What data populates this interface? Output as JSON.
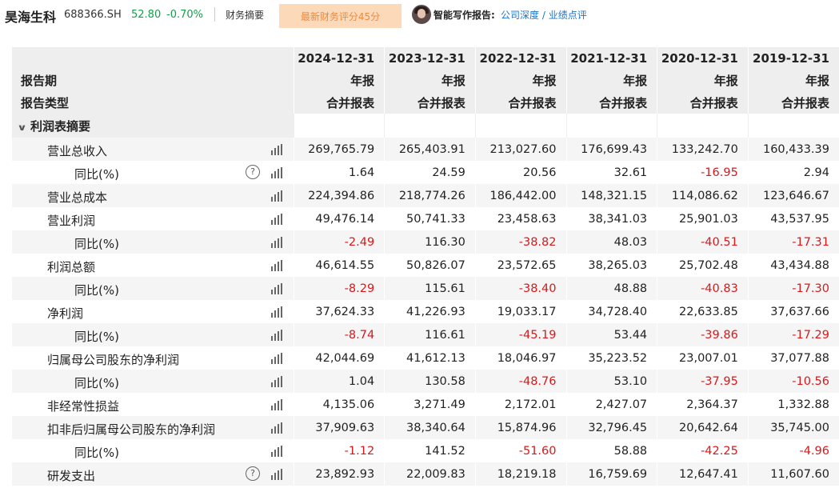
{
  "header": {
    "stock_name": "昊海生科",
    "stock_code": "688366.SH",
    "price": "52.80",
    "change_pct": "-0.70%",
    "tab_summary": "财务摘要",
    "score_button": "最新财务评分45分",
    "report_label": "智能写作报告:",
    "report_link_1": "公司深度",
    "report_link_sep": " / ",
    "report_link_2": "业绩点评",
    "colors": {
      "down": "#14a04a",
      "negative": "#d7191c",
      "link": "#1b74c8",
      "score_bg": "#fcd9b8",
      "score_text": "#f08a3b"
    }
  },
  "table": {
    "label_period": "报告期",
    "label_type": "报告类型",
    "columns": [
      {
        "date": "2024-12-31",
        "period": "年报",
        "type": "合并报表"
      },
      {
        "date": "2023-12-31",
        "period": "年报",
        "type": "合并报表"
      },
      {
        "date": "2022-12-31",
        "period": "年报",
        "type": "合并报表"
      },
      {
        "date": "2021-12-31",
        "period": "年报",
        "type": "合并报表"
      },
      {
        "date": "2020-12-31",
        "period": "年报",
        "type": "合并报表"
      },
      {
        "date": "2019-12-31",
        "period": "年报",
        "type": "合并报表"
      }
    ],
    "section_title": "利润表摘要",
    "rows": [
      {
        "label": "营业总收入",
        "level": 1,
        "help": false,
        "values": [
          "269,765.79",
          "265,403.91",
          "213,027.60",
          "176,699.43",
          "133,242.70",
          "160,433.39"
        ]
      },
      {
        "label": "同比(%)",
        "level": 2,
        "help": true,
        "values": [
          "1.64",
          "24.59",
          "20.56",
          "32.61",
          "-16.95",
          "2.94"
        ]
      },
      {
        "label": "营业总成本",
        "level": 1,
        "help": false,
        "values": [
          "224,394.86",
          "218,774.26",
          "186,442.00",
          "148,321.15",
          "114,086.62",
          "123,646.67"
        ]
      },
      {
        "label": "营业利润",
        "level": 1,
        "help": false,
        "values": [
          "49,476.14",
          "50,741.33",
          "23,458.63",
          "38,341.03",
          "25,901.03",
          "43,537.95"
        ]
      },
      {
        "label": "同比(%)",
        "level": 2,
        "help": false,
        "values": [
          "-2.49",
          "116.30",
          "-38.82",
          "48.03",
          "-40.51",
          "-17.31"
        ]
      },
      {
        "label": "利润总额",
        "level": 1,
        "help": false,
        "values": [
          "46,614.55",
          "50,826.07",
          "23,572.65",
          "38,265.03",
          "25,702.48",
          "43,434.88"
        ]
      },
      {
        "label": "同比(%)",
        "level": 2,
        "help": false,
        "values": [
          "-8.29",
          "115.61",
          "-38.40",
          "48.88",
          "-40.83",
          "-17.30"
        ]
      },
      {
        "label": "净利润",
        "level": 1,
        "help": false,
        "values": [
          "37,624.33",
          "41,226.93",
          "19,033.17",
          "34,728.40",
          "22,633.85",
          "37,637.66"
        ]
      },
      {
        "label": "同比(%)",
        "level": 2,
        "help": false,
        "values": [
          "-8.74",
          "116.61",
          "-45.19",
          "53.44",
          "-39.86",
          "-17.29"
        ]
      },
      {
        "label": "归属母公司股东的净利润",
        "level": 1,
        "help": false,
        "values": [
          "42,044.69",
          "41,612.13",
          "18,046.97",
          "35,223.52",
          "23,007.01",
          "37,077.88"
        ]
      },
      {
        "label": "同比(%)",
        "level": 2,
        "help": false,
        "values": [
          "1.04",
          "130.58",
          "-48.76",
          "53.10",
          "-37.95",
          "-10.56"
        ]
      },
      {
        "label": "非经常性损益",
        "level": 1,
        "help": false,
        "values": [
          "4,135.06",
          "3,271.49",
          "2,172.01",
          "2,427.07",
          "2,364.37",
          "1,332.88"
        ]
      },
      {
        "label": "扣非后归属母公司股东的净利润",
        "level": 1,
        "help": false,
        "values": [
          "37,909.63",
          "38,340.64",
          "15,874.96",
          "32,796.45",
          "20,642.64",
          "35,745.00"
        ]
      },
      {
        "label": "同比(%)",
        "level": 2,
        "help": false,
        "values": [
          "-1.12",
          "141.52",
          "-51.60",
          "58.88",
          "-42.25",
          "-4.96"
        ]
      },
      {
        "label": "研发支出",
        "level": 1,
        "help": true,
        "values": [
          "23,892.93",
          "22,009.83",
          "18,219.18",
          "16,759.69",
          "12,647.41",
          "11,607.60"
        ]
      }
    ]
  }
}
